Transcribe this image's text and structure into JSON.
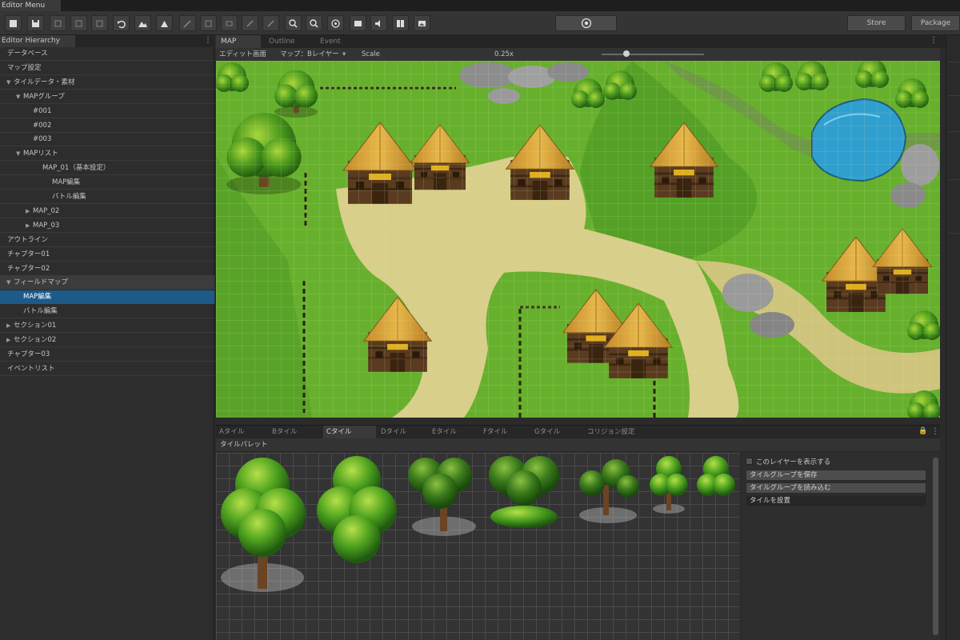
{
  "title_tab": "Editor Menu",
  "toolbar": {
    "buttons": [
      "new-icon",
      "open-icon",
      "save-icon",
      "copy-icon",
      "paste-icon",
      "delete-icon",
      "undo-icon",
      "mountain-icon",
      "triangle-icon",
      "pencil-icon",
      "rectangle-icon",
      "ellipse-icon",
      "fill-icon",
      "eyedropper-icon",
      "zoom-in-icon",
      "zoom-out-icon",
      "target-icon",
      "layers-icon",
      "sound-icon",
      "book-icon",
      "image-icon"
    ],
    "play_icon": "play-circle-icon",
    "store_label": "Store",
    "package_label": "Package"
  },
  "hierarchy": {
    "panel_title": "Editor Hierarchy",
    "items": [
      {
        "label": "データベース",
        "indent": 0,
        "arrow": ""
      },
      {
        "label": "マップ設定",
        "indent": 0,
        "arrow": ""
      },
      {
        "label": "タイルデータ・素材",
        "indent": 1,
        "arrow": "▼"
      },
      {
        "label": "MAPグループ",
        "indent": 2,
        "arrow": "▼"
      },
      {
        "label": "#001",
        "indent": 3,
        "arrow": ""
      },
      {
        "label": "#002",
        "indent": 3,
        "arrow": ""
      },
      {
        "label": "#003",
        "indent": 3,
        "arrow": ""
      },
      {
        "label": "MAPリスト",
        "indent": 2,
        "arrow": "▼"
      },
      {
        "label": "MAP_01（基本設定）",
        "indent": 4,
        "arrow": ""
      },
      {
        "label": "MAP編集",
        "indent": 5,
        "arrow": ""
      },
      {
        "label": "バトル編集",
        "indent": 5,
        "arrow": ""
      },
      {
        "label": "MAP_02",
        "indent": 3,
        "arrow": "▶"
      },
      {
        "label": "MAP_03",
        "indent": 3,
        "arrow": "▶"
      },
      {
        "label": "アウトライン",
        "indent": 0,
        "arrow": ""
      },
      {
        "label": "チャプター01",
        "indent": 0,
        "arrow": ""
      },
      {
        "label": "チャプター02",
        "indent": 0,
        "arrow": ""
      },
      {
        "label": "フィールドマップ",
        "indent": 1,
        "arrow": "▼"
      },
      {
        "label": "MAP編集",
        "indent": 2,
        "arrow": ""
      },
      {
        "label": "バトル編集",
        "indent": 2,
        "arrow": ""
      },
      {
        "label": "セクション01",
        "indent": 1,
        "arrow": "▶"
      },
      {
        "label": "セクション02",
        "indent": 1,
        "arrow": "▶"
      },
      {
        "label": "チャプター03",
        "indent": 0,
        "arrow": ""
      },
      {
        "label": "イベントリスト",
        "indent": 0,
        "arrow": ""
      }
    ]
  },
  "map_tabs": [
    "MAP",
    "Outline",
    "Event"
  ],
  "map_options": {
    "mode": "エディット画面",
    "layer": "マップ：Bレイヤー",
    "scale_label": "Scale",
    "scale_value": "0.25x",
    "scale_fraction": 0.24
  },
  "tile_tabs": [
    "Aタイル",
    "Bタイル",
    "Cタイル",
    "Dタイル",
    "Eタイル",
    "Fタイル",
    "Gタイル",
    "コリジョン設定"
  ],
  "tile_palette": {
    "label": "タイルパレット",
    "options": {
      "checkbox": "このレイヤーを表示する",
      "btn1": "タイルグループを保存",
      "btn2": "タイルグループを読み込む",
      "btn3": "タイルを設置"
    }
  }
}
